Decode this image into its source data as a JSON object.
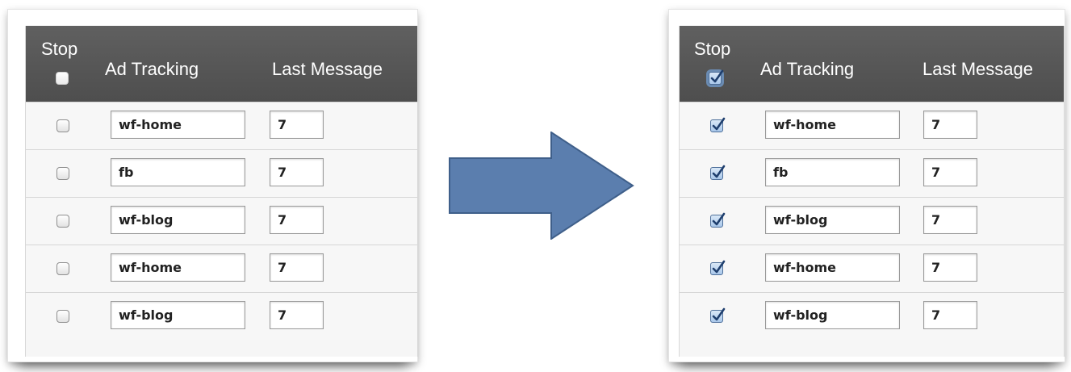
{
  "before": {
    "headers": {
      "stop": "Stop",
      "ad_tracking": "Ad Tracking",
      "last_message": "Last Message"
    },
    "select_all_checked": false,
    "rows": [
      {
        "checked": false,
        "ad_tracking": "wf-home",
        "last_message": "7"
      },
      {
        "checked": false,
        "ad_tracking": "fb",
        "last_message": "7"
      },
      {
        "checked": false,
        "ad_tracking": "wf-blog",
        "last_message": "7"
      },
      {
        "checked": false,
        "ad_tracking": "wf-home",
        "last_message": "7"
      },
      {
        "checked": false,
        "ad_tracking": "wf-blog",
        "last_message": "7"
      }
    ]
  },
  "after": {
    "headers": {
      "stop": "Stop",
      "ad_tracking": "Ad Tracking",
      "last_message": "Last Message"
    },
    "select_all_checked": true,
    "rows": [
      {
        "checked": true,
        "ad_tracking": "wf-home",
        "last_message": "7"
      },
      {
        "checked": true,
        "ad_tracking": "fb",
        "last_message": "7"
      },
      {
        "checked": true,
        "ad_tracking": "wf-blog",
        "last_message": "7"
      },
      {
        "checked": true,
        "ad_tracking": "wf-home",
        "last_message": "7"
      },
      {
        "checked": true,
        "ad_tracking": "wf-blog",
        "last_message": "7"
      }
    ]
  },
  "transition_arrow": {
    "icon": "right-arrow-icon",
    "color": "#5b7eae"
  },
  "colors": {
    "header_bg": "#565656",
    "header_text": "#ffffff",
    "row_bg": "#f7f7f7",
    "checkbox_checked": "#b9d2ee",
    "checkmark": "#1f3f6e"
  }
}
